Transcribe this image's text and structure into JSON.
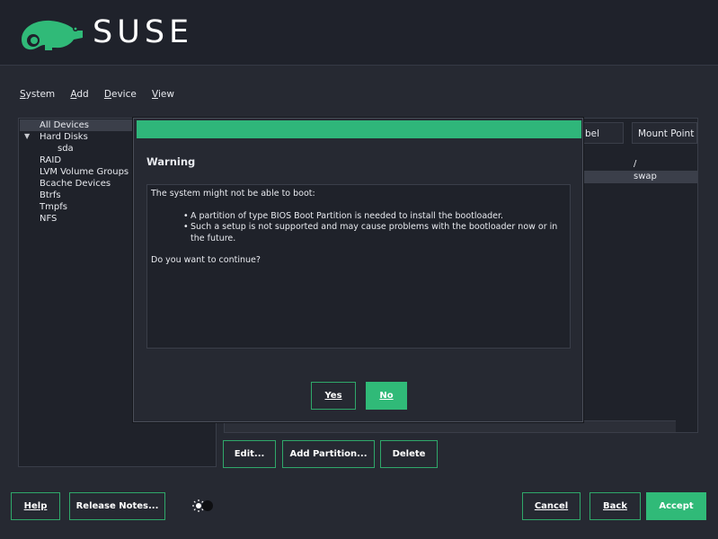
{
  "brand": {
    "name": "SUSE",
    "color": "#30ba78"
  },
  "menu": [
    "System",
    "Add",
    "Device",
    "View"
  ],
  "tree": {
    "items": [
      {
        "label": "All Devices",
        "level": 0,
        "selected": true
      },
      {
        "label": "Hard Disks",
        "level": 0,
        "expanded": true
      },
      {
        "label": "sda",
        "level": 1
      },
      {
        "label": "RAID",
        "level": 0
      },
      {
        "label": "LVM Volume Groups",
        "level": 0
      },
      {
        "label": "Bcache Devices",
        "level": 0
      },
      {
        "label": "Btrfs",
        "level": 0
      },
      {
        "label": "Tmpfs",
        "level": 0
      },
      {
        "label": "NFS",
        "level": 0
      }
    ],
    "expand_icon": "triangle-down-icon"
  },
  "table": {
    "columns": [
      "bel",
      "Mount Point"
    ],
    "rows": [
      {
        "mount": "/"
      },
      {
        "mount": "swap"
      }
    ]
  },
  "actions": {
    "edit": "Edit...",
    "add_partition": "Add Partition...",
    "delete": "Delete"
  },
  "dialog": {
    "title": "Warning",
    "intro": "The system might not be able to boot:",
    "bullets": [
      "A partition of type BIOS Boot Partition is needed to install the bootloader.",
      "Such a setup is not supported and may cause problems with the bootloader now or in the future."
    ],
    "question": "Do you want to continue?",
    "yes": "Yes",
    "no": "No"
  },
  "footer": {
    "help": "Help",
    "release_notes": "Release Notes...",
    "cancel": "Cancel",
    "back": "Back",
    "accept": "Accept",
    "theme_icon": "sun-moon-toggle-icon"
  }
}
